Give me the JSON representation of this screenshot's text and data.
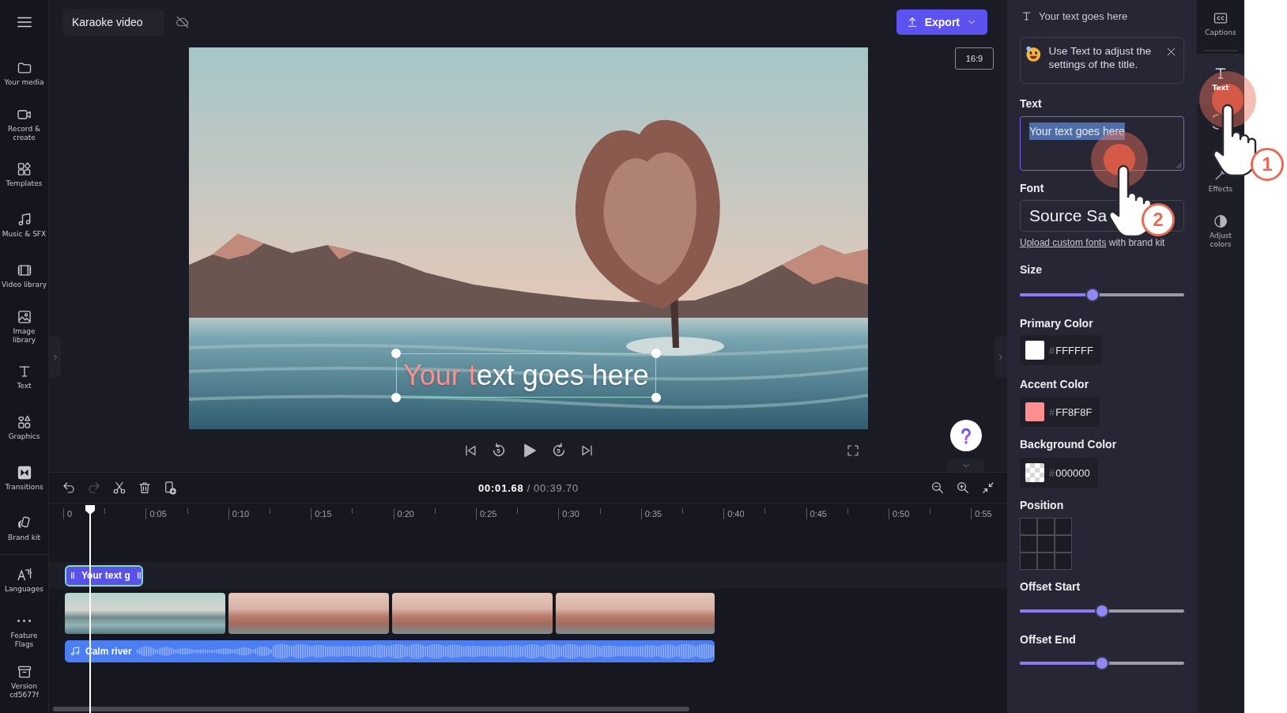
{
  "sidebar": {
    "items": [
      {
        "label": "Your media"
      },
      {
        "label": "Record & create"
      },
      {
        "label": "Templates"
      },
      {
        "label": "Music & SFX"
      },
      {
        "label": "Video library"
      },
      {
        "label": "Image library"
      },
      {
        "label": "Text"
      },
      {
        "label": "Graphics"
      },
      {
        "label": "Transitions"
      },
      {
        "label": "Brand kit"
      },
      {
        "label": "Languages"
      },
      {
        "label": "Feature Flags"
      },
      {
        "label": "Version cd5677f"
      }
    ]
  },
  "top_bar": {
    "project_title": "Karaoke video",
    "export_button": "Export"
  },
  "preview": {
    "aspect_ratio": "16:9",
    "caption": {
      "sung": "Your t",
      "unsung": "ext goes here",
      "selected": true
    }
  },
  "player": {
    "seek_back": "5",
    "seek_forward": "5"
  },
  "timeline": {
    "tools": [
      {
        "disabled": false
      },
      {
        "disabled": true
      },
      {
        "disabled": false
      },
      {
        "disabled": false
      },
      {
        "disabled": false
      }
    ],
    "current_time": "00:01.68",
    "separator": "/",
    "total_time": "00:39.70",
    "ruler": [
      "0",
      "0:05",
      "0:10",
      "0:15",
      "0:20",
      "0:25",
      "0:30",
      "0:35",
      "0:40",
      "0:45",
      "0:50",
      "0:55"
    ],
    "text_clip": {
      "label": "Your text g",
      "selected": true
    },
    "audio_clip": {
      "label": "Calm river"
    }
  },
  "properties": {
    "title": "Your text goes here",
    "tip": "Use Text to adjust the settings of the title.",
    "text_label": "Text",
    "text_value": "Your text goes here",
    "text_highlighted": true,
    "font_label": "Font",
    "font_value": "Source Sa",
    "font_hint": {
      "link": "Upload custom fonts",
      "rest": "with brand kit"
    },
    "size": {
      "label": "Size",
      "level": 0.44
    },
    "colors": [
      {
        "label": "Primary Color",
        "kind": "solid",
        "color": "#ffffff",
        "prefix": "#",
        "value": "FFFFFF"
      },
      {
        "label": "Accent Color",
        "kind": "solid",
        "color": "#ff8f8f",
        "prefix": "#",
        "value": "FF8F8F"
      },
      {
        "label": "Background Color",
        "kind": "checker",
        "prefix": "#",
        "value": "000000"
      }
    ],
    "position_label": "Position",
    "offsets": [
      {
        "label": "Offset Start",
        "level": 0.5
      },
      {
        "label": "Offset End",
        "level": 0.5
      }
    ]
  },
  "side_tabs": [
    {
      "label": "Captions",
      "selected": false
    },
    {
      "label": "Text",
      "selected": true
    },
    {
      "selected": false
    },
    {
      "label": "Effects",
      "selected": false
    },
    {
      "label": "Adjust colors",
      "selected": false
    }
  ],
  "annotations": [
    {
      "step": "1"
    },
    {
      "step": "2"
    }
  ]
}
